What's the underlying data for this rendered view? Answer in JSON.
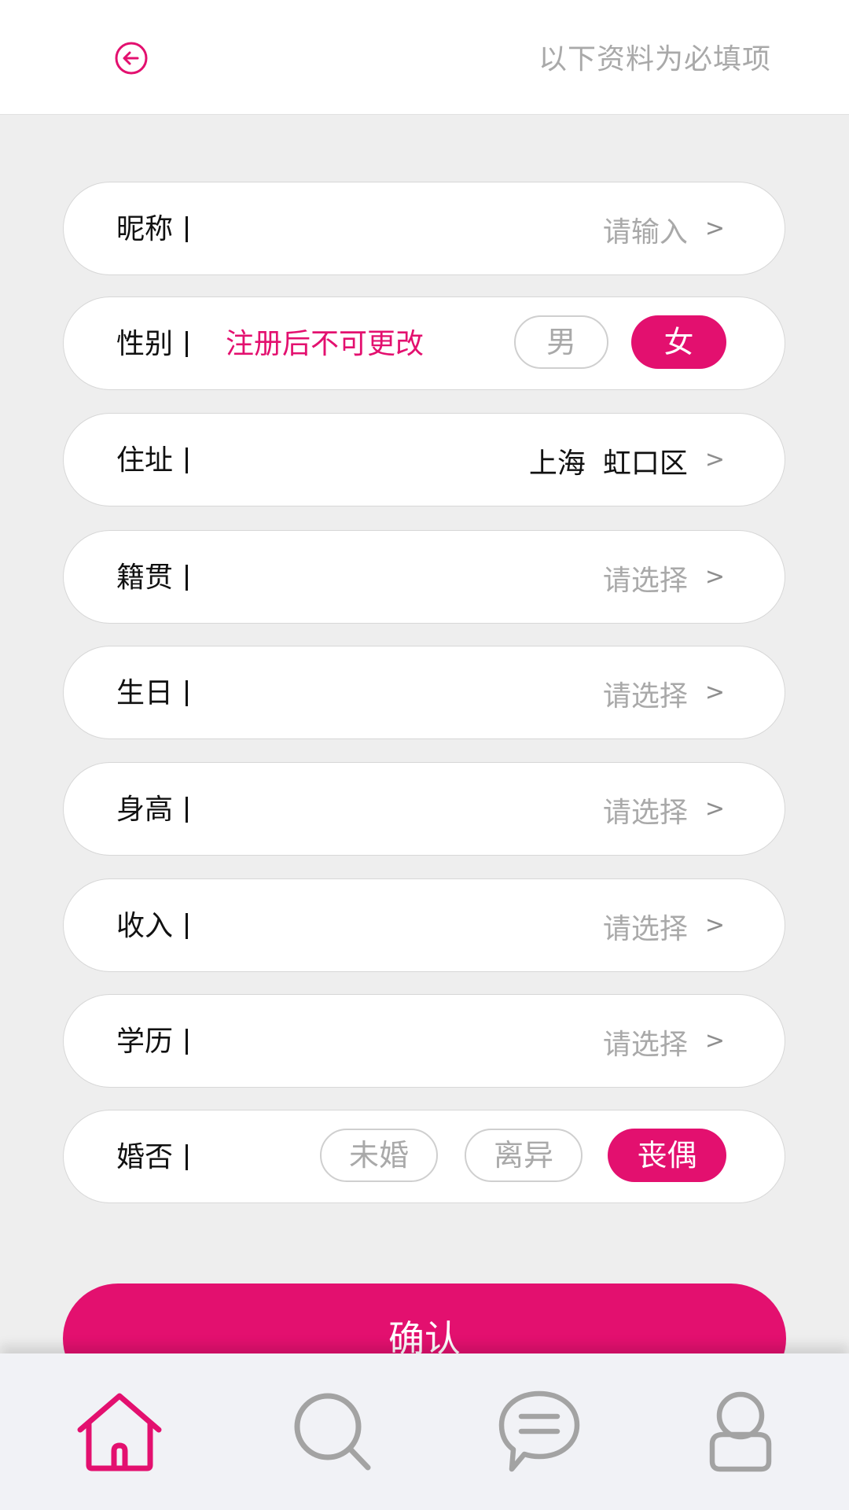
{
  "header": {
    "note": "以下资料为必填项"
  },
  "colors": {
    "accent": "#e3106f",
    "inactive_icon": "#a3a3a3",
    "placeholder": "#a9a9a9"
  },
  "form": {
    "chevron": ">",
    "nickname": {
      "label": "昵称",
      "placeholder": "请输入"
    },
    "gender": {
      "label": "性别",
      "hint": "注册后不可更改",
      "options": [
        "男",
        "女"
      ],
      "selected": "女"
    },
    "address": {
      "label": "住址",
      "city": "上海",
      "district": "虹口区"
    },
    "hometown": {
      "label": "籍贯",
      "placeholder": "请选择"
    },
    "birthday": {
      "label": "生日",
      "placeholder": "请选择"
    },
    "height": {
      "label": "身高",
      "placeholder": "请选择"
    },
    "income": {
      "label": "收入",
      "placeholder": "请选择"
    },
    "education": {
      "label": "学历",
      "placeholder": "请选择"
    },
    "marital": {
      "label": "婚否",
      "options": [
        "未婚",
        "离异",
        "丧偶"
      ],
      "selected": "丧偶"
    }
  },
  "confirm": {
    "label": "确认"
  },
  "nav": {
    "items": [
      {
        "icon": "home-icon",
        "active": true
      },
      {
        "icon": "search-icon",
        "active": false
      },
      {
        "icon": "chat-icon",
        "active": false
      },
      {
        "icon": "user-icon",
        "active": false
      }
    ]
  }
}
